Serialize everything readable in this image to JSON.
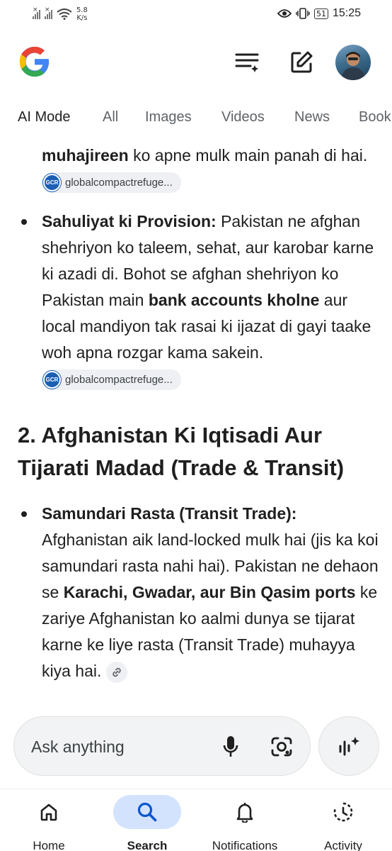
{
  "status_bar": {
    "net_speed_value": "5.8",
    "net_speed_unit": "K/s",
    "battery": "51",
    "time": "15:25"
  },
  "header": {
    "logo_letter": "G",
    "accent_colors": {
      "blue": "#4285F4",
      "red": "#EA4335",
      "yellow": "#FBBC05",
      "green": "#34A853"
    }
  },
  "tabs": [
    {
      "label": "AI Mode",
      "active": true
    },
    {
      "label": "All"
    },
    {
      "label": "Images"
    },
    {
      "label": "Videos"
    },
    {
      "label": "News"
    },
    {
      "label": "Book"
    }
  ],
  "content": {
    "p1": {
      "bold": "muhajireen",
      "text1": " ko apne mulk main panah di hai. ",
      "chip_logo": "GCR",
      "chip_text": "globalcompactrefuge..."
    },
    "p2": {
      "bold1": "Sahuliyat ki Provision:",
      "text1": " Pakistan ne afghan shehriyon ko taleem, sehat, aur karobar karne ki azadi di. Bohot se afghan shehriyon ko Pakistan main ",
      "bold2": "bank accounts kholne",
      "text2": " aur local mandiyon tak rasai ki ijazat di gayi taake woh apna rozgar kama sakein. ",
      "chip_logo": "GCR",
      "chip_text": "globalcompactrefuge..."
    },
    "heading": "2. Afghanistan Ki Iqtisadi Aur Tijarati Madad (Trade & Transit)",
    "p3": {
      "bold1": "Samundari Rasta (Transit Trade):",
      "text1": " Afghanistan aik land-locked mulk hai (jis ka koi samundari rasta nahi hai). Pakistan ne dehaon se ",
      "bold2": "Karachi, Gwadar, aur Bin Qasim ports",
      "text2": " ke zariye Afghanistan ko aalmi dunya se tijarat karne ke liye rasta (Transit Trade) muhayya kiya hai. "
    }
  },
  "ask": {
    "placeholder": "Ask anything"
  },
  "bottom_nav": [
    {
      "label": "Home",
      "icon": "home-icon"
    },
    {
      "label": "Search",
      "icon": "search-icon",
      "active": true
    },
    {
      "label": "Notifications",
      "icon": "bell-icon"
    },
    {
      "label": "Activity",
      "icon": "activity-icon"
    }
  ]
}
